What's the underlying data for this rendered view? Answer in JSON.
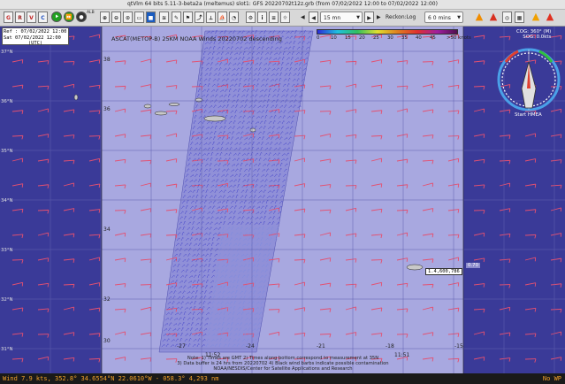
{
  "window": {
    "title": "qtVlm 64 bits 5.11-3-beta2a (meltemus)  slot1: GFS 20220702t12z.grb (from 07/02/2022 12:00 to 07/02/2022 12:00)"
  },
  "toolbar": {
    "icons": [
      {
        "name": "grib-icon",
        "glyph": "G",
        "color": "#c83030"
      },
      {
        "name": "raster-icon",
        "glyph": "R",
        "color": "#a02020"
      },
      {
        "name": "vlm-icon",
        "glyph": "V",
        "color": "#c02020"
      },
      {
        "name": "cloud-icon",
        "glyph": "C",
        "color": "#2050c0"
      }
    ],
    "round_buttons": [
      {
        "name": "play-icon",
        "glyph": "⯈",
        "color": "#20a020"
      },
      {
        "name": "forward-icon",
        "glyph": "⏩",
        "color": "#20a020"
      },
      {
        "name": "record-icon",
        "glyph": "●",
        "color": "#333333"
      }
    ],
    "time_step": "15 mn",
    "reckon_label": "Reckon:Log",
    "interval": "6 0 mins",
    "small_label": "ALB",
    "prev_arrow": "◀",
    "next_arrow": "▶"
  },
  "map": {
    "info_box": {
      "line1": "Ref : 07/02/2022 12:00",
      "line2": "Sat 07/02/2022 12:00",
      "line3": "(UTC)"
    },
    "ascat_title": "ASCAT(METOP-B) 25KM NOAA Winds 20220702 descending",
    "legend": {
      "ticks": [
        "0",
        "10",
        "15",
        "20",
        "25",
        "30",
        "35",
        "40",
        "45"
      ],
      "unit": ">50 knots"
    },
    "cursor_label": "1.4,600,786",
    "cursor_label2": "0.70",
    "lat_labels": [
      "38",
      "36",
      "34",
      "32",
      "30"
    ],
    "lon_labels": [
      "-27",
      "-24",
      "-21",
      "-18",
      "-15"
    ],
    "lon_top_labels": [
      "11:52",
      "11:51"
    ],
    "side_labels": [
      "37°N",
      "36°N",
      "35°N",
      "34°N",
      "33°N",
      "32°N",
      "31°N"
    ],
    "notes": {
      "line1": "Note: 1) Times are GMT  2) Times along bottom correspond to measurement at 35N",
      "line2": "3) Data buffer is 24 hrs from 20220702  4) Black wind barbs indicate possible contamination",
      "line3": "NOAA/NESDIS/Center for Satellite Applications and Research"
    },
    "compass": {
      "cog": "COG: 360° (M)",
      "sog": "SOG: 0.0kts",
      "start": "Start HMEA"
    }
  },
  "status": {
    "left": "Wind 7.9 kts, 352.8°   34.6554°N 22.0610°W - 058.3°  4,293 nm",
    "right": "No WP"
  },
  "colors": {
    "ocean": "#3a3a98",
    "swath": "#9a9ad4",
    "barb_red": "#e45070",
    "barb_blue": "#5050d8",
    "status_text": "#f2a12a"
  }
}
